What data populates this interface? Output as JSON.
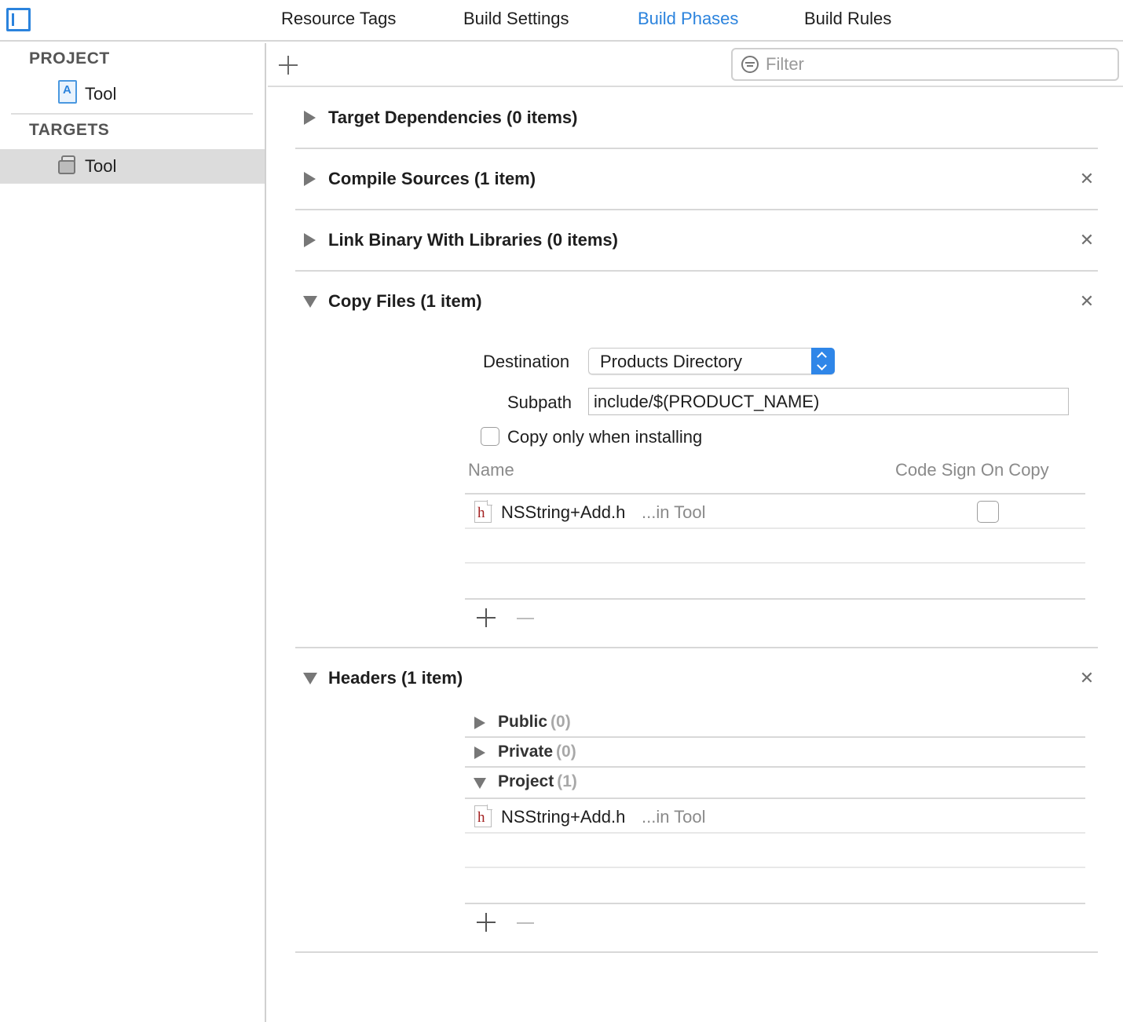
{
  "tabs": [
    {
      "label": "Resource Tags",
      "active": false
    },
    {
      "label": "Build Settings",
      "active": false
    },
    {
      "label": "Build Phases",
      "active": true
    },
    {
      "label": "Build Rules",
      "active": false
    }
  ],
  "accent_color": "#2b83dd",
  "sidebar": {
    "project_heading": "PROJECT",
    "project_item": "Tool",
    "targets_heading": "TARGETS",
    "target_item": "Tool"
  },
  "toolbar": {
    "filter_placeholder": "Filter"
  },
  "phases": {
    "target_dependencies": "Target Dependencies (0 items)",
    "compile_sources": "Compile Sources (1 item)",
    "link_binary": "Link Binary With Libraries (0 items)",
    "copy_files": {
      "title": "Copy Files (1 item)",
      "destination_label": "Destination",
      "destination_value": "Products Directory",
      "subpath_label": "Subpath",
      "subpath_value": "include/$(PRODUCT_NAME)",
      "copy_only_label": "Copy only when installing",
      "columns": [
        "Name",
        "Code Sign On Copy"
      ],
      "files": [
        {
          "icon": "h",
          "name": "NSString+Add.h",
          "location": "...in Tool"
        }
      ]
    },
    "headers": {
      "title": "Headers (1 item)",
      "groups": [
        {
          "name": "Public",
          "count": "(0)"
        },
        {
          "name": "Private",
          "count": "(0)"
        },
        {
          "name": "Project",
          "count": "(1)"
        }
      ],
      "files": [
        {
          "icon": "h",
          "name": "NSString+Add.h",
          "location": "...in Tool"
        }
      ]
    }
  }
}
